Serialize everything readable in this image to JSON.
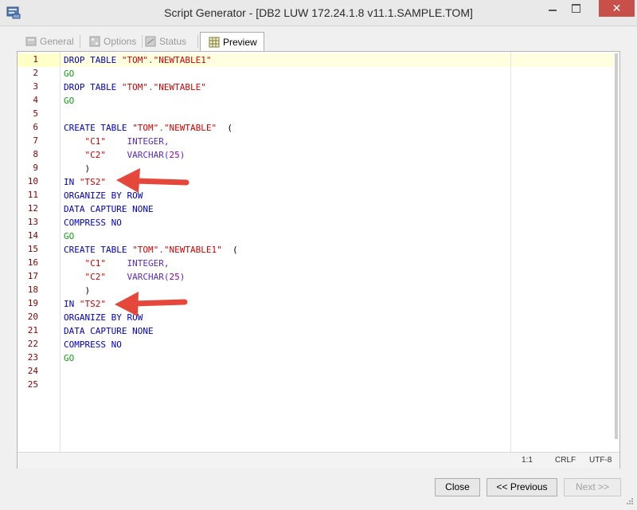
{
  "window": {
    "title": "Script Generator - [DB2 LUW 172.24.1.8 v11.1.SAMPLE.TOM]",
    "close_glyph": "✕"
  },
  "tabs": [
    {
      "label": "General",
      "icon": "general-icon",
      "active": false
    },
    {
      "label": "Options",
      "icon": "options-icon",
      "active": false
    },
    {
      "label": "Status",
      "icon": "status-icon",
      "active": false
    },
    {
      "label": "Preview",
      "icon": "preview-icon",
      "active": true
    }
  ],
  "editor": {
    "line_numbers": [
      "1",
      "2",
      "3",
      "4",
      "5",
      "6",
      "7",
      "8",
      "9",
      "10",
      "11",
      "12",
      "13",
      "14",
      "15",
      "16",
      "17",
      "18",
      "19",
      "20",
      "21",
      "22",
      "23",
      "24",
      "25"
    ],
    "code": {
      "drop_table": "DROP TABLE",
      "create_table": "CREATE TABLE",
      "schema": "\"TOM\"",
      "dot": ".",
      "table1": "\"NEWTABLE1\"",
      "table": "\"NEWTABLE\"",
      "go": "GO",
      "open_paren": "(",
      "close_paren": ")",
      "c1": "\"C1\"",
      "c2": "\"C2\"",
      "integer": "INTEGER,",
      "varchar": "VARCHAR(",
      "varchar_len": "25",
      "varchar_close": ")",
      "in_kw": "IN",
      "tablespace": "\"TS2\"",
      "organize": "ORGANIZE BY ROW",
      "data_capture": "DATA CAPTURE NONE",
      "compress": "COMPRESS NO"
    },
    "status": {
      "position": "1:1",
      "line_ending": "CRLF",
      "encoding": "UTF-8"
    }
  },
  "buttons": {
    "close": "Close",
    "previous": "<< Previous",
    "next": "Next >>"
  },
  "colors": {
    "keyword": "#0000cc",
    "string": "#d40000",
    "go": "#12a012",
    "number": "#9900aa",
    "line_number": "#8b0000",
    "annotation_arrow": "#e5473a",
    "close_button": "#c7504b"
  }
}
